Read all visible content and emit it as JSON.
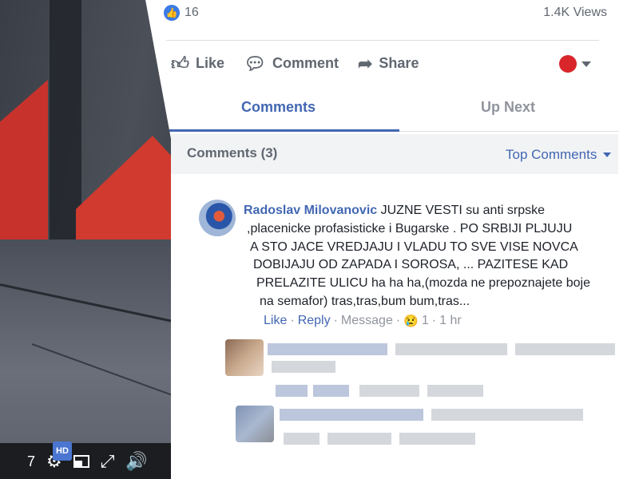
{
  "video": {
    "controls": {
      "hd_badge": "HD",
      "icons": [
        "settings-icon",
        "pip-icon",
        "fullscreen-icon",
        "volume-icon"
      ]
    }
  },
  "stats": {
    "likes": "16",
    "views": "1.4K Views"
  },
  "actions": {
    "like": "Like",
    "comment": "Comment",
    "share": "Share"
  },
  "tabs": {
    "comments": "Comments",
    "up_next": "Up Next"
  },
  "comments_header": {
    "count": "Comments (3)",
    "sort": "Top Comments"
  },
  "comment": {
    "author": "Radoslav Milovanovic",
    "lines": [
      "JUZNE VESTI su anti srpske",
      ",placenicke profasisticke i Bugarske . PO SRBIJI PLJUJU",
      "A STO JACE VREDJAJU I VLADU TO SVE VISE NOVCA",
      "DOBIJAJU OD ZAPADA I SOROSA, ... PAZITESE KAD",
      "PRELAZITE ULICU ha ha ha,(mozda ne prepoznajete boje",
      "na semafor) tras,tras,bum bum,tras..."
    ],
    "like_label": "Like",
    "reply_label": "Reply",
    "message_label": "Message",
    "reaction_count": "1",
    "time": "1 hr",
    "separator": "·"
  },
  "colors": {
    "link_blue": "#4267b2",
    "muted": "#606770",
    "brand_like": "#3b7be5"
  }
}
